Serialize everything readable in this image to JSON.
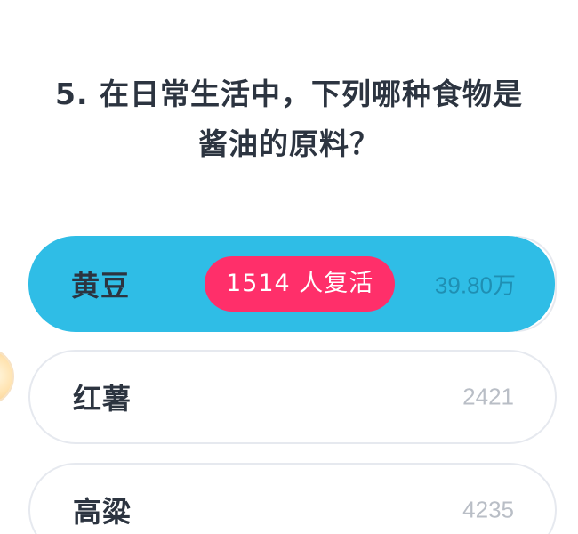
{
  "question": {
    "line1": "5. 在日常生活中，下列哪种食物是",
    "line2": "酱油的原料？"
  },
  "options": [
    {
      "label": "黄豆",
      "count": "39.80万",
      "selected": true
    },
    {
      "label": "红薯",
      "count": "2421",
      "selected": false
    },
    {
      "label": "高粱",
      "count": "4235",
      "selected": false
    }
  ],
  "revive_badge": "1514 人复活",
  "colors": {
    "selected_bg": "#2fbde6",
    "badge_bg": "#ff2f6a",
    "text_dark": "#2c3440",
    "count_gray": "#b9bec6"
  },
  "side_icon": "mascot-avatar-icon"
}
